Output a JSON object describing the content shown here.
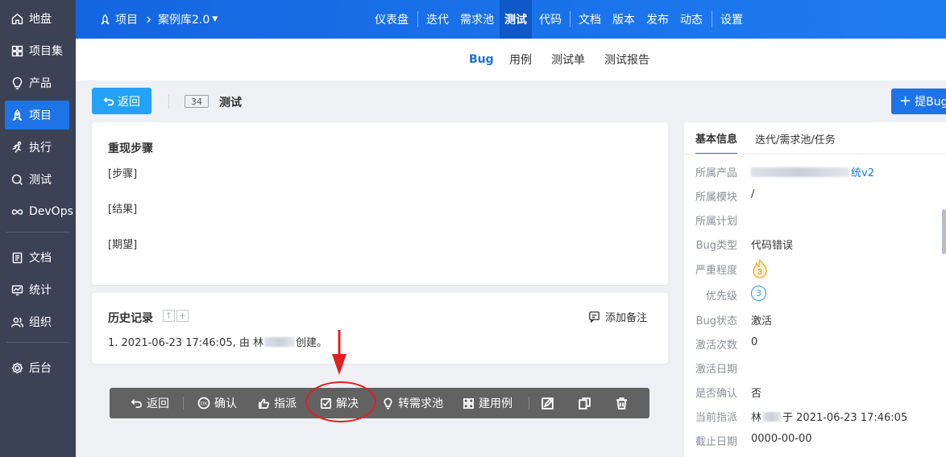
{
  "sidebar": {
    "items": [
      {
        "label": "地盘",
        "icon": "home-icon"
      },
      {
        "label": "项目集",
        "icon": "grid-icon"
      },
      {
        "label": "产品",
        "icon": "lightbulb-icon"
      },
      {
        "label": "项目",
        "icon": "rocket-icon"
      },
      {
        "label": "执行",
        "icon": "run-icon"
      },
      {
        "label": "测试",
        "icon": "search-icon"
      },
      {
        "label": "DevOps",
        "icon": "infinity-icon"
      },
      {
        "label": "文档",
        "icon": "document-icon"
      },
      {
        "label": "统计",
        "icon": "chart-icon"
      },
      {
        "label": "组织",
        "icon": "users-icon"
      },
      {
        "label": "后台",
        "icon": "gear-icon"
      }
    ],
    "active": "项目"
  },
  "header": {
    "breadcrumb_root": "项目",
    "breadcrumb_project": "案例库2.0",
    "nav": [
      "仪表盘",
      "迭代",
      "需求池",
      "测试",
      "代码",
      "文档",
      "版本",
      "发布",
      "动态",
      "设置"
    ],
    "active_nav": "测试"
  },
  "subnav": {
    "items": [
      "Bug",
      "用例",
      "测试单",
      "测试报告"
    ],
    "active": "Bug"
  },
  "actions": {
    "back_label": "返回",
    "id": "34",
    "title": "测试",
    "report_label": "提Bug"
  },
  "steps": {
    "title": "重现步骤",
    "lines": [
      "[步骤]",
      "[结果]",
      "[期望]"
    ]
  },
  "history": {
    "title": "历史记录",
    "add_note": "添加备注",
    "entry_prefix": "1. 2021-06-23 17:46:05, 由 林",
    "entry_suffix": "创建。"
  },
  "toolbar": {
    "items": [
      {
        "label": "返回",
        "icon": "undo-icon"
      },
      {
        "label": "确认",
        "icon": "ok-icon"
      },
      {
        "label": "指派",
        "icon": "thumb-icon"
      },
      {
        "label": "解决",
        "icon": "checkbox-icon"
      },
      {
        "label": "转需求池",
        "icon": "lightbulb-icon"
      },
      {
        "label": "建用例",
        "icon": "blocks-icon"
      }
    ],
    "icon_buttons": [
      "edit-icon",
      "copy-icon",
      "trash-icon"
    ]
  },
  "info": {
    "tabs": [
      "基本信息",
      "迭代/需求池/任务"
    ],
    "active_tab": "基本信息",
    "rows": [
      {
        "label": "所属产品",
        "value": "统v2"
      },
      {
        "label": "所属模块",
        "value": "/"
      },
      {
        "label": "所属计划",
        "value": ""
      },
      {
        "label": "Bug类型",
        "value": "代码错误"
      },
      {
        "label": "严重程度",
        "value": "3"
      },
      {
        "label": "优先级",
        "value": "3"
      },
      {
        "label": "Bug状态",
        "value": "激活"
      },
      {
        "label": "激活次数",
        "value": "0"
      },
      {
        "label": "激活日期",
        "value": ""
      },
      {
        "label": "是否确认",
        "value": "否"
      },
      {
        "label": "当前指派",
        "value_prefix": "林",
        "value": "于 2021-06-23 17:46:05"
      },
      {
        "label": "截止日期",
        "value": "0000-00-00"
      }
    ]
  },
  "colors": {
    "primary": "#1e74e6",
    "sidebar": "#3b4254",
    "annotation": "#e41f1f",
    "severity": "#f5a623"
  }
}
